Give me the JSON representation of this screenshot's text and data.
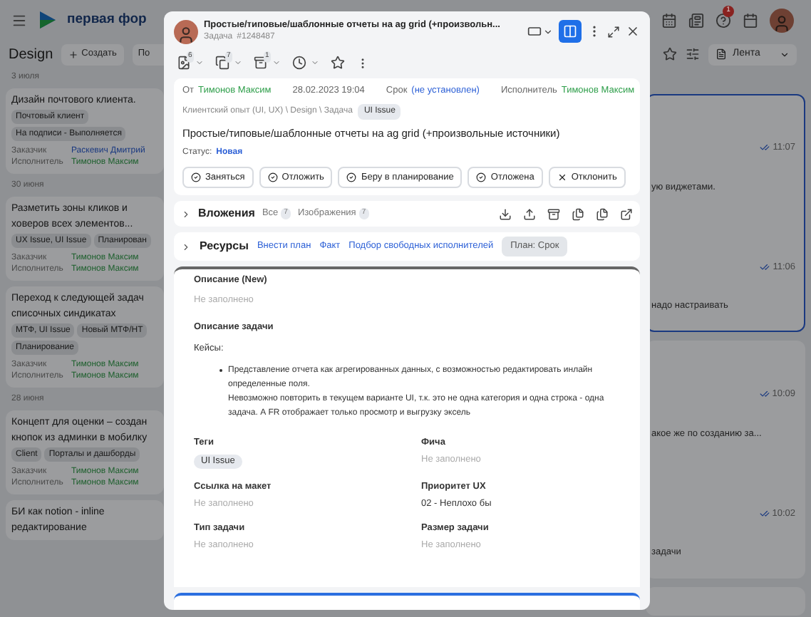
{
  "topbar": {
    "app_name": "первая фор",
    "notification_count": "1"
  },
  "board": {
    "title": "Design",
    "create_button": "Создать",
    "cut_button": "По",
    "view_select": "Лента"
  },
  "groups": [
    {
      "date": "3 июля",
      "cards": [
        {
          "title_lines": [
            "Дизайн почтового клиента."
          ],
          "tags": [
            "Почтовый клиент",
            "На подписи - Выполняется"
          ],
          "customer_label": "Заказчик",
          "customer": {
            "name": "Раскевич Дмитрий",
            "color": "#1a3980"
          },
          "assignee_label": "Исполнитель",
          "assignee": "Тимонов Максим"
        }
      ]
    },
    {
      "date": "30 июня",
      "cards": [
        {
          "title_lines": [
            "Разметить зоны кликов и",
            "ховеров всех элементов..."
          ],
          "tags": [
            "UX Issue, UI Issue",
            "Планирован"
          ],
          "customer_label": "Заказчик",
          "customer": {
            "name": "Тимонов Максим",
            "color": "#1c5f2c"
          },
          "assignee_label": "Исполнитель",
          "assignee": "Тимонов Максим"
        },
        {
          "title_lines": [
            "Переход к следующей задач",
            "списочных синдикатах"
          ],
          "tags": [
            "МТФ, UI Issue",
            "Новый МТФ/НТ",
            "Планирование"
          ],
          "customer_label": "Заказчик",
          "customer": {
            "name": "Тимонов Максим",
            "color": "#1c5f2c"
          },
          "assignee_label": "Исполнитель",
          "assignee": "Тимонов Максим"
        }
      ]
    },
    {
      "date": "28 июня",
      "cards": [
        {
          "title_lines": [
            "Концепт для оценки – создан",
            "кнопок из админки в мобилку"
          ],
          "tags": [
            "Client",
            "Порталы и дашборды"
          ],
          "customer_label": "Заказчик",
          "customer": {
            "name": "Тимонов Максим",
            "color": "#1c5f2c"
          },
          "assignee_label": "Исполнитель",
          "assignee": "Тимонов Максим"
        },
        {
          "title_lines": [
            "БИ как notion - inline",
            "редактирование"
          ]
        }
      ]
    }
  ],
  "feed": [
    {
      "highlighted": true,
      "entries": [
        {
          "time": "11:07",
          "snippet": "ую виджетами."
        },
        {
          "time": "11:06",
          "snippet": "надо настраивать"
        }
      ]
    },
    {
      "highlighted": false,
      "entries": [
        {
          "time": "10:09",
          "snippet": "акое же по созданию за..."
        },
        {
          "time": "10:02",
          "snippet": "задачи"
        }
      ]
    }
  ],
  "task": {
    "title": "Простые/типовые/шаблонные отчеты на ag grid (+произвольн...",
    "type": "Задача",
    "number": "#1248487",
    "toolbar_badges": [
      "6",
      "7",
      "1"
    ],
    "from_label": "От",
    "from": "Тимонов Максим",
    "created": "28.02.2023 19:04",
    "due_label": "Срок",
    "due": "(не установлен)",
    "assignee_label": "Исполнитель",
    "assignee": "Тимонов Максим",
    "path": "Клиентский опыт (UI, UX) \\ Design \\ Задача",
    "path_tag": "UI Issue",
    "full_title": "Простые/типовые/шаблонные отчеты на ag grid (+произвольные источники)",
    "status_label": "Статус:",
    "status": "Новая",
    "actions": [
      {
        "label": "Заняться",
        "kind": "check"
      },
      {
        "label": "Отложить",
        "kind": "check"
      },
      {
        "label": "Беру в планирование",
        "kind": "check"
      },
      {
        "label": "Отложена",
        "kind": "check"
      },
      {
        "label": "Отклонить",
        "kind": "cross"
      }
    ],
    "attachments": {
      "title": "Вложения",
      "filters": [
        {
          "label": "Все",
          "count": "7"
        },
        {
          "label": "Изображения",
          "count": "7"
        }
      ]
    },
    "resources": {
      "title": "Ресурсы",
      "links": [
        "Внести план",
        "Факт",
        "Подбор свободных исполнителей"
      ],
      "chip": "План: Срок"
    },
    "description_new": {
      "label": "Описание (New)",
      "value": "Не заполнено",
      "empty": true
    },
    "description": {
      "label": "Описание задачи",
      "intro": "Кейсы:",
      "bullets": [
        "Представление отчета как агрегированных данных, с возможностью редактировать инлайн определенные поля.\nНевозможно повторить в текущем варианте UI, т.к. это не одна категория и одна строка - одна задача. А FR отображает только просмотр и выгрузку эксель"
      ]
    },
    "fields": [
      {
        "label": "Теги",
        "value": "UI Issue",
        "kind": "tag"
      },
      {
        "label": "Фича",
        "value": "Не заполнено",
        "kind": "empty"
      },
      {
        "label": "Ссылка на макет",
        "value": "Не заполнено",
        "kind": "empty"
      },
      {
        "label": "Приоритет UX",
        "value": "02 - Неплохо бы",
        "kind": "text"
      },
      {
        "label": "Тип задачи",
        "value": "Не заполнено",
        "kind": "empty"
      },
      {
        "label": "Размер задачи",
        "value": "Не заполнено",
        "kind": "empty"
      }
    ]
  }
}
